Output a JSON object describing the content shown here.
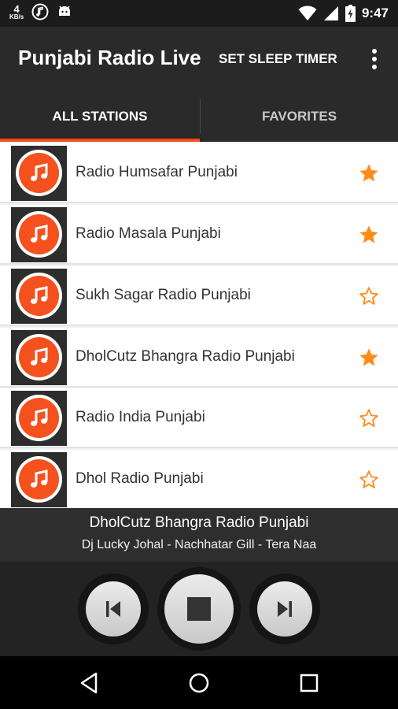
{
  "status_bar": {
    "net_speed": "4",
    "net_unit": "KB/s",
    "time": "9:47",
    "icons": [
      "music-note-icon",
      "android-icon",
      "wifi-icon",
      "cell-signal-icon",
      "battery-charging-icon"
    ]
  },
  "app_bar": {
    "title": "Punjabi Radio Live",
    "sleep_timer_label": "SET SLEEP TIMER",
    "overflow_icon": "more-vert-icon"
  },
  "tabs": [
    {
      "label": "ALL STATIONS",
      "selected": true
    },
    {
      "label": "FAVORITES",
      "selected": false
    }
  ],
  "stations": [
    {
      "name": "Radio Humsafar Punjabi",
      "favorite": true
    },
    {
      "name": "Radio Masala Punjabi",
      "favorite": true
    },
    {
      "name": "Sukh Sagar Radio Punjabi",
      "favorite": false
    },
    {
      "name": "DholCutz Bhangra Radio Punjabi",
      "favorite": true
    },
    {
      "name": "Radio India Punjabi",
      "favorite": false
    },
    {
      "name": "Dhol Radio Punjabi",
      "favorite": false
    }
  ],
  "now_playing": {
    "station": "DholCutz Bhangra Radio Punjabi",
    "track": "Dj Lucky Johal - Nachhatar Gill - Tera Naa"
  },
  "controls": {
    "previous_icon": "skip-previous-icon",
    "stop_icon": "stop-icon",
    "next_icon": "skip-next-icon"
  },
  "nav": [
    "back-icon",
    "home-icon",
    "recents-icon"
  ],
  "colors": {
    "accent": "#f4511e",
    "star": "#ff8c1a",
    "app_bar": "#2a2a2a"
  }
}
